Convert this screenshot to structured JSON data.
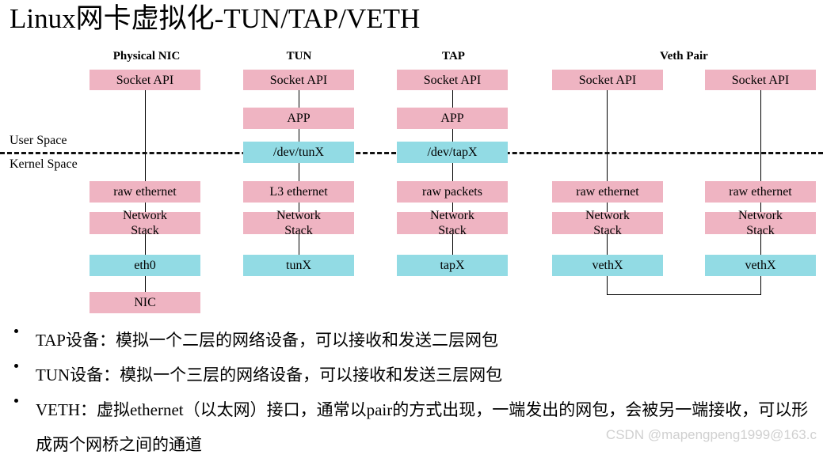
{
  "title": "Linux网卡虚拟化-TUN/TAP/VETH",
  "colors": {
    "pink": "#efb4c2",
    "cyan": "#92dbe4",
    "line": "#000000",
    "watermark": "#d0d0d0"
  },
  "space_labels": {
    "user": "User Space",
    "kernel": "Kernel Space"
  },
  "columns": [
    {
      "header": "Physical NIC",
      "boxes": [
        {
          "label": "Socket API",
          "color": "pink"
        },
        {
          "label": "raw ethernet",
          "color": "pink"
        },
        {
          "label": "Network\nStack",
          "color": "pink"
        },
        {
          "label": "eth0",
          "color": "cyan"
        },
        {
          "label": "NIC",
          "color": "pink"
        }
      ]
    },
    {
      "header": "TUN",
      "boxes": [
        {
          "label": "Socket API",
          "color": "pink"
        },
        {
          "label": "APP",
          "color": "pink"
        },
        {
          "label": "/dev/tunX",
          "color": "cyan"
        },
        {
          "label": "L3 ethernet",
          "color": "pink"
        },
        {
          "label": "Network\nStack",
          "color": "pink"
        },
        {
          "label": "tunX",
          "color": "cyan"
        }
      ]
    },
    {
      "header": "TAP",
      "boxes": [
        {
          "label": "Socket API",
          "color": "pink"
        },
        {
          "label": "APP",
          "color": "pink"
        },
        {
          "label": "/dev/tapX",
          "color": "cyan"
        },
        {
          "label": "raw packets",
          "color": "pink"
        },
        {
          "label": "Network\nStack",
          "color": "pink"
        },
        {
          "label": "tapX",
          "color": "cyan"
        }
      ]
    },
    {
      "header": "Veth Pair",
      "boxes": [
        {
          "label": "Socket API",
          "color": "pink"
        },
        {
          "label": "raw ethernet",
          "color": "pink"
        },
        {
          "label": "Network\nStack",
          "color": "pink"
        },
        {
          "label": "vethX",
          "color": "cyan"
        },
        {
          "label": "Socket API",
          "color": "pink"
        },
        {
          "label": "raw ethernet",
          "color": "pink"
        },
        {
          "label": "Network\nStack",
          "color": "pink"
        },
        {
          "label": "vethX",
          "color": "cyan"
        }
      ]
    }
  ],
  "bullets": [
    "TAP设备：模拟一个二层的网络设备，可以接收和发送二层网包",
    "TUN设备：模拟一个三层的网络设备，可以接收和发送三层网包",
    "VETH：虚拟ethernet（以太网）接口，通常以pair的方式出现，一端发出的网包，会被另一端接收，可以形成两个网桥之间的通道"
  ],
  "watermark": "CSDN @mapengpeng1999@163.c"
}
